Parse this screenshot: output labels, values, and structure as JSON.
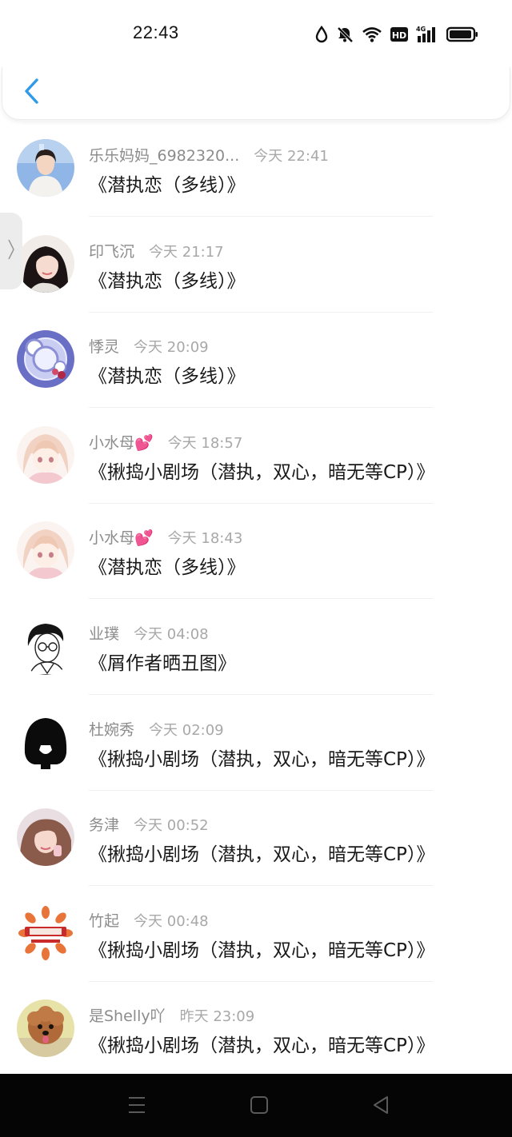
{
  "status_bar": {
    "time": "22:43",
    "icons": [
      "drop-icon",
      "bell-muted-icon",
      "wifi-icon",
      "hd-icon",
      "signal-4g-icon",
      "battery-icon"
    ],
    "hd_label": "HD",
    "network_label": "4G"
  },
  "nav": {
    "back_icon": "chevron-left-icon",
    "accent": "#2f9be8"
  },
  "messages": [
    {
      "name": "乐乐妈妈_6982320...",
      "time": "今天 22:41",
      "title": "《潜执恋（多线）》",
      "avatar": "photo-woman"
    },
    {
      "name": "印飞沉",
      "time": "今天 21:17",
      "title": "《潜执恋（多线）》",
      "avatar": "photo-girl"
    },
    {
      "name": "悸灵",
      "time": "今天 20:09",
      "title": "《潜执恋（多线）》",
      "avatar": "bubbles-art"
    },
    {
      "name": "小水母💕",
      "time": "今天 18:57",
      "title": "《揪捣小剧场（潜执，双心，暗无等CP）》",
      "avatar": "anime-girl"
    },
    {
      "name": "小水母💕",
      "time": "今天 18:43",
      "title": "《潜执恋（多线）》",
      "avatar": "anime-girl"
    },
    {
      "name": "业璞",
      "time": "今天 04:08",
      "title": "《屑作者晒丑图》",
      "avatar": "sketch-boy"
    },
    {
      "name": "杜婉秀",
      "time": "今天 02:09",
      "title": "《揪捣小剧场（潜执，双心，暗无等CP）》",
      "avatar": "black-silhouette"
    },
    {
      "name": "务津",
      "time": "今天 00:52",
      "title": "《揪捣小剧场（潜执，双心，暗无等CP）》",
      "avatar": "photo-girl-pink"
    },
    {
      "name": "竹起",
      "time": "今天 00:48",
      "title": "《揪捣小剧场（潜执，双心，暗无等CP）》",
      "avatar": "logo-badge"
    },
    {
      "name": "是Shelly吖",
      "time": "昨天 23:09",
      "title": "《揪捣小剧场（潜执，双心，暗无等CP）》",
      "avatar": "puppy"
    }
  ],
  "system_nav": {
    "icons": [
      "menu-icon",
      "home-icon",
      "back-triangle-icon"
    ]
  }
}
